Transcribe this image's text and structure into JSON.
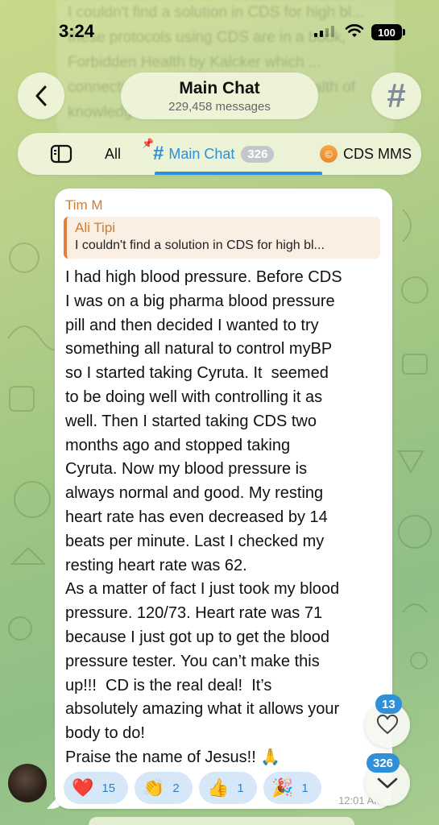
{
  "status_bar": {
    "time": "3:24",
    "battery": "100"
  },
  "background_text": "I couldn't find a solution in CDS for high bl... these protocols using CDS are in a book, Forbidden Health by Kalcker which ... connection of the ... a library of a wealth of knowledge",
  "header": {
    "title": "Main Chat",
    "subtitle": "229,458 messages",
    "back_icon": "chevron-left-icon",
    "hash_icon": "hash-icon"
  },
  "tabs": {
    "items": [
      {
        "label": "",
        "icon": "sidebar-icon"
      },
      {
        "label": "All"
      },
      {
        "label": "Main Chat",
        "icon": "hash-icon",
        "badge": "326",
        "active": true
      },
      {
        "label": "CDS MMS",
        "icon": "cds-avatar-icon"
      }
    ]
  },
  "message": {
    "sender": "Tim M",
    "reply_name": "Ali Tipi",
    "reply_text": "I couldn't find a solution in CDS for high bl...",
    "text": "I had high blood pressure. Before CDS\nI was on a big pharma blood pressure\npill and then decided I wanted to try\nsomething all natural to control myBP\nso I started taking Cyruta. It  seemed\nto be doing well with controlling it as\nwell. Then I started taking CDS two\nmonths ago and stopped taking\nCyruta. Now my blood pressure is\nalways normal and good. My resting\nheart rate has even decreased by 14\nbeats per minute. Last I checked my\nresting heart rate was 62.\nAs a matter of fact I just took my blood\npressure. 120/73. Heart rate was 71\nbecause I just got up to get the blood\npressure tester. You can’t make this\nup!!!  CD is the real deal!  It’s\nabsolutely amazing what it allows your\nbody to do!\nPraise the name of Jesus!! 🙏",
    "time": "12:01 AM",
    "reactions": [
      {
        "emoji": "❤️",
        "count": "15"
      },
      {
        "emoji": "👏",
        "count": "2"
      },
      {
        "emoji": "👍",
        "count": "1"
      },
      {
        "emoji": "🎉",
        "count": "1"
      }
    ]
  },
  "floating": {
    "reactions_badge": "13",
    "unread_badge": "326"
  },
  "colors": {
    "accent": "#2f8fd8",
    "sender": "#d57b2f",
    "reaction_bg": "#d6e8f7"
  }
}
